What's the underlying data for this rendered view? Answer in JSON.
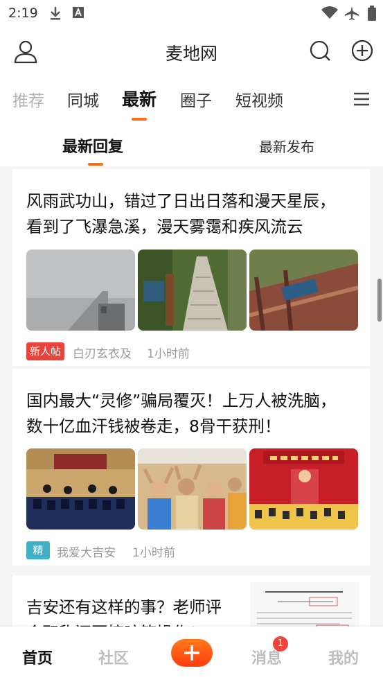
{
  "status_bar": {
    "time": "2:19",
    "left_icons": [
      "download-icon",
      "text-a-icon"
    ],
    "right_icons": [
      "wifi-icon",
      "airplane-icon",
      "battery-icon"
    ]
  },
  "header": {
    "title": "麦地网",
    "left_icon": "user-icon",
    "right_icons": [
      "search-icon",
      "add-circle-icon"
    ]
  },
  "category_tabs": [
    {
      "label": "推荐",
      "state": "faded"
    },
    {
      "label": "同城",
      "state": "normal"
    },
    {
      "label": "最新",
      "state": "active"
    },
    {
      "label": "圈子",
      "state": "normal"
    },
    {
      "label": "短视频",
      "state": "normal"
    }
  ],
  "sub_tabs": [
    {
      "label": "最新回复",
      "active": true
    },
    {
      "label": "最新发布",
      "active": false
    }
  ],
  "posts": [
    {
      "title_line1": "风雨武功山，错过了日出日落和漫天星辰，",
      "title_line2": "看到了飞瀑急溪，漫天雾霭和疾风流云",
      "badge": "新人帖",
      "author": "白刃玄衣及",
      "time": "1小时前"
    },
    {
      "title_line1": "国内最大“灵修”骗局覆灭！上万人被洗脑，",
      "title_line2": "数十亿血汗钱被卷走，8骨干获刑！",
      "badge": "精",
      "author": "我爱大吉安",
      "time": "1小时前"
    },
    {
      "title_line1": "吉安还有这样的事？老师评",
      "title_line2": "会职称还要搞暗箱操作?"
    }
  ],
  "bottom_nav": {
    "items": [
      {
        "label": "首页",
        "active": true
      },
      {
        "label": "社区",
        "active": false
      },
      {
        "label": "消息",
        "active": false,
        "badge": "1"
      },
      {
        "label": "我的",
        "active": false
      }
    ]
  },
  "colors": {
    "accent": "#ff6a10",
    "new_badge": "#e8443c",
    "jing_badge": "#3fb0c8"
  }
}
